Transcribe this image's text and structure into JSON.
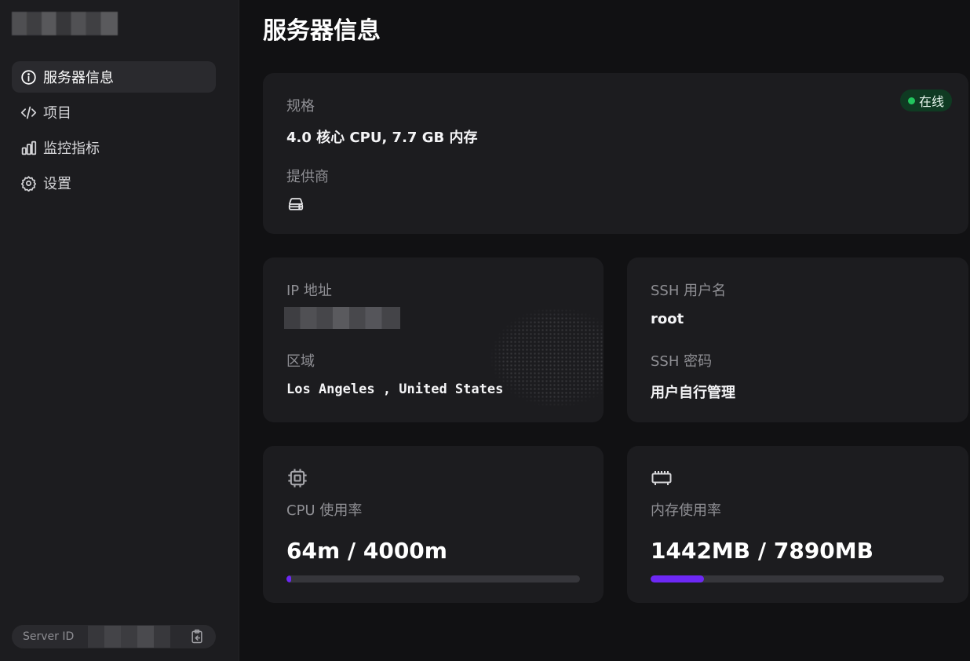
{
  "sidebar": {
    "items": [
      {
        "label": "服务器信息",
        "icon": "info-icon",
        "active": true
      },
      {
        "label": "项目",
        "icon": "code-icon",
        "active": false
      },
      {
        "label": "监控指标",
        "icon": "bar-chart-icon",
        "active": false
      },
      {
        "label": "设置",
        "icon": "gear-icon",
        "active": false
      }
    ],
    "server_id_label": "Server ID"
  },
  "page": {
    "title": "服务器信息"
  },
  "spec_card": {
    "spec_label": "规格",
    "spec_value": "4.0 核心 CPU, 7.7 GB 内存",
    "provider_label": "提供商",
    "provider_icon": "server-icon",
    "status": "在线",
    "status_color": "#22c55e"
  },
  "network_card": {
    "ip_label": "IP 地址",
    "region_label": "区域",
    "region_value": "Los Angeles , United States"
  },
  "ssh_card": {
    "user_label": "SSH 用户名",
    "user_value": "root",
    "password_label": "SSH 密码",
    "password_value": "用户自行管理"
  },
  "cpu_card": {
    "icon": "cpu-icon",
    "label": "CPU 使用率",
    "value": "64m / 4000m",
    "usage_fraction": 0.016
  },
  "memory_card": {
    "icon": "memory-icon",
    "label": "内存使用率",
    "value": "1442MB / 7890MB",
    "usage_fraction": 0.183
  },
  "colors": {
    "accent": "#6d28f5",
    "online": "#22c55e"
  }
}
